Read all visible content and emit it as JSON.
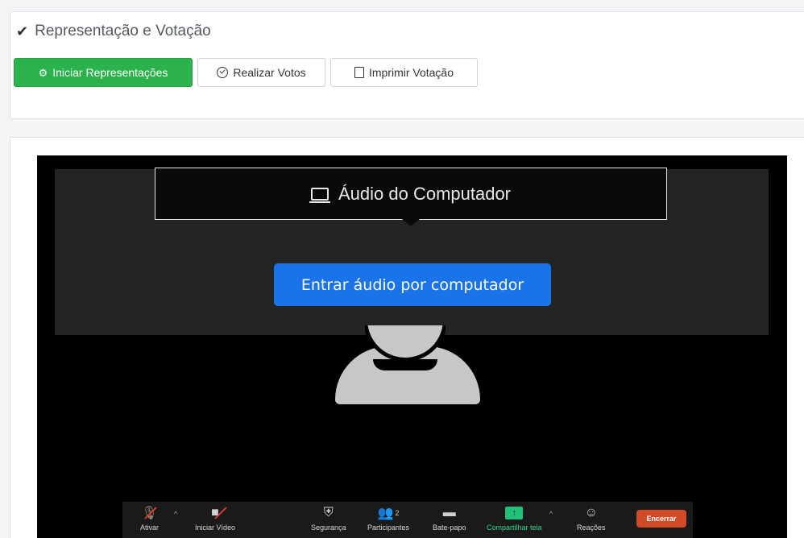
{
  "section": {
    "title": "Representação e Votação",
    "check_icon": "checkmark-icon"
  },
  "actions": {
    "start_label": "Iniciar Representações",
    "vote_label": "Realizar Votos",
    "print_label": "Imprimir Votação"
  },
  "colors": {
    "green": "#2bb24c",
    "join_blue": "#1a73e8",
    "end_red": "#d14b2b",
    "share_green": "#21c17a"
  },
  "zoom": {
    "audio_tooltip": "Áudio do Computador",
    "join_button": "Entrar áudio por computador",
    "toolbar": {
      "mute": "Ativar",
      "video": "Iniciar Vídeo",
      "security": "Segurança",
      "participants": "Participantes",
      "participants_count": "2",
      "chat": "Bate-papo",
      "share": "Compartilhar tela",
      "reactions": "Reações",
      "end": "Encerrar"
    }
  }
}
